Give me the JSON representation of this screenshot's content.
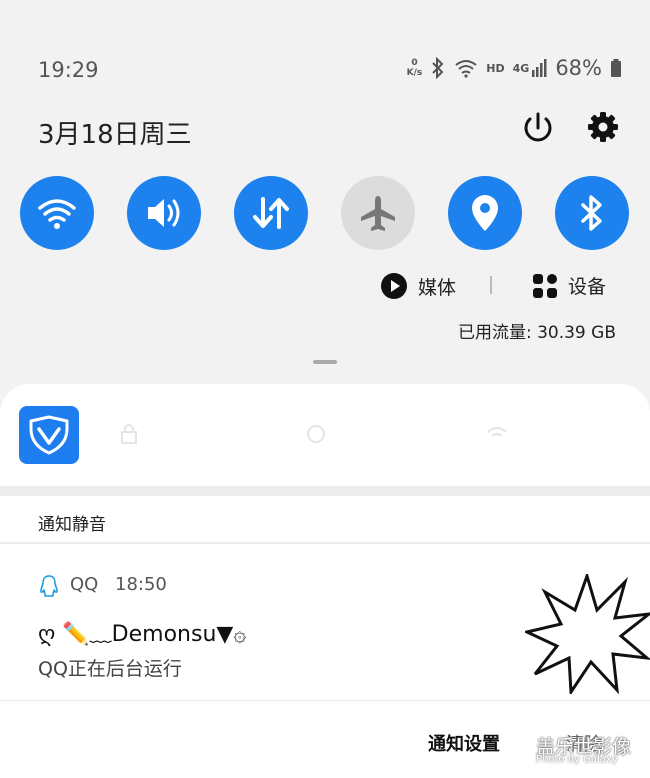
{
  "status_bar": {
    "time": "19:29",
    "net_speed_value": "0",
    "net_speed_unit": "K/s",
    "hd_label": "HD",
    "network_label": "4G",
    "battery": "68%",
    "icons": [
      "bluetooth-icon",
      "wifi-icon",
      "signal-icon",
      "battery-icon"
    ]
  },
  "header": {
    "date": "3月18日周三",
    "power_icon": "power-icon",
    "settings_icon": "gear-icon"
  },
  "quick_toggles": [
    {
      "name": "wifi",
      "icon": "wifi-icon",
      "active": true
    },
    {
      "name": "sound",
      "icon": "volume-icon",
      "active": true
    },
    {
      "name": "mobile-data",
      "icon": "data-arrows-icon",
      "active": true
    },
    {
      "name": "airplane",
      "icon": "airplane-icon",
      "active": false
    },
    {
      "name": "location",
      "icon": "location-icon",
      "active": true
    },
    {
      "name": "bluetooth",
      "icon": "bluetooth-icon",
      "active": true
    }
  ],
  "media_row": {
    "media_label": "媒体",
    "device_label": "设备",
    "divider": "|"
  },
  "data_usage": "已用流量: 30.39 GB",
  "colors": {
    "accent": "#1d82ee",
    "toggle_off": "#dcdcdc",
    "background": "#f2f2f2"
  },
  "silent_section": {
    "header": "通知静音"
  },
  "notification": {
    "app": "QQ",
    "time": "18:50",
    "title": "ღ ✏️﹏Demonsu▼۞",
    "body": "QQ正在后台运行"
  },
  "footer": {
    "settings": "通知设置",
    "clear": "清除"
  },
  "watermark": {
    "main": "盖乐世影像",
    "sub": "Photo by Galaxy"
  }
}
